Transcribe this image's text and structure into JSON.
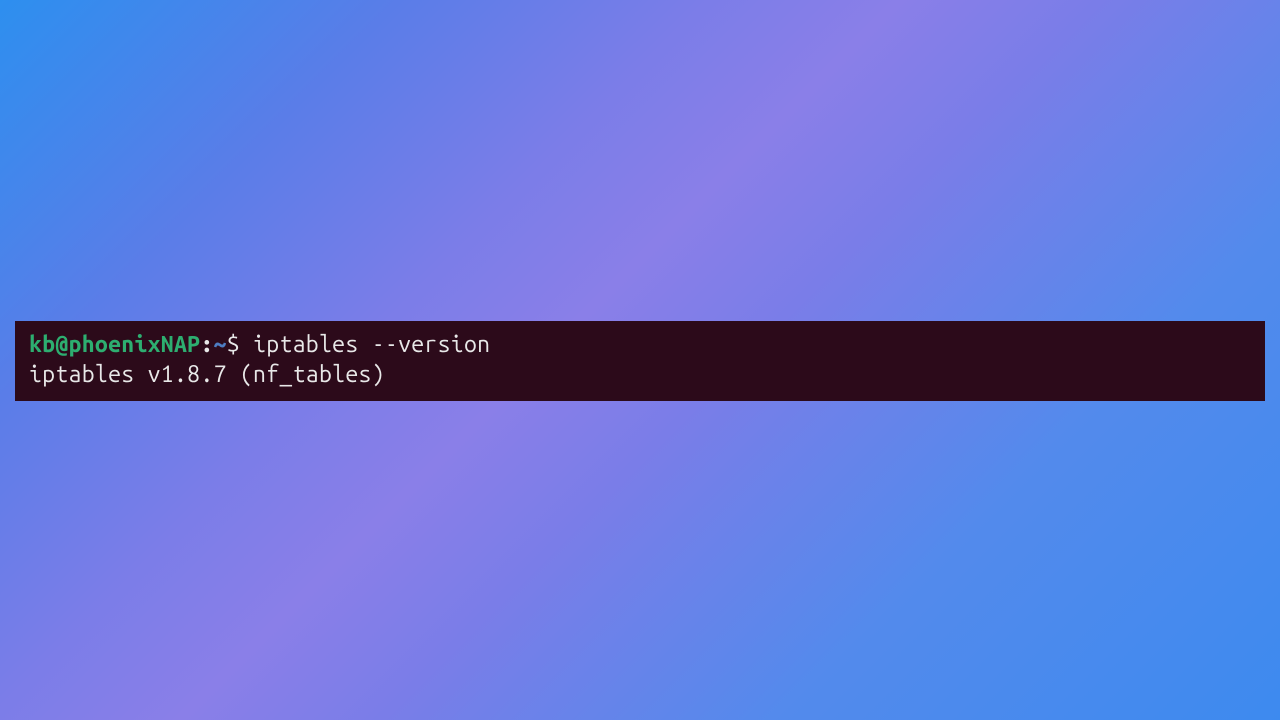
{
  "terminal": {
    "prompt": {
      "user_host": "kb@phoenixNAP",
      "separator": ":",
      "path": "~",
      "symbol": "$"
    },
    "command": " iptables --version",
    "output": "iptables v1.8.7 (nf_tables)"
  }
}
